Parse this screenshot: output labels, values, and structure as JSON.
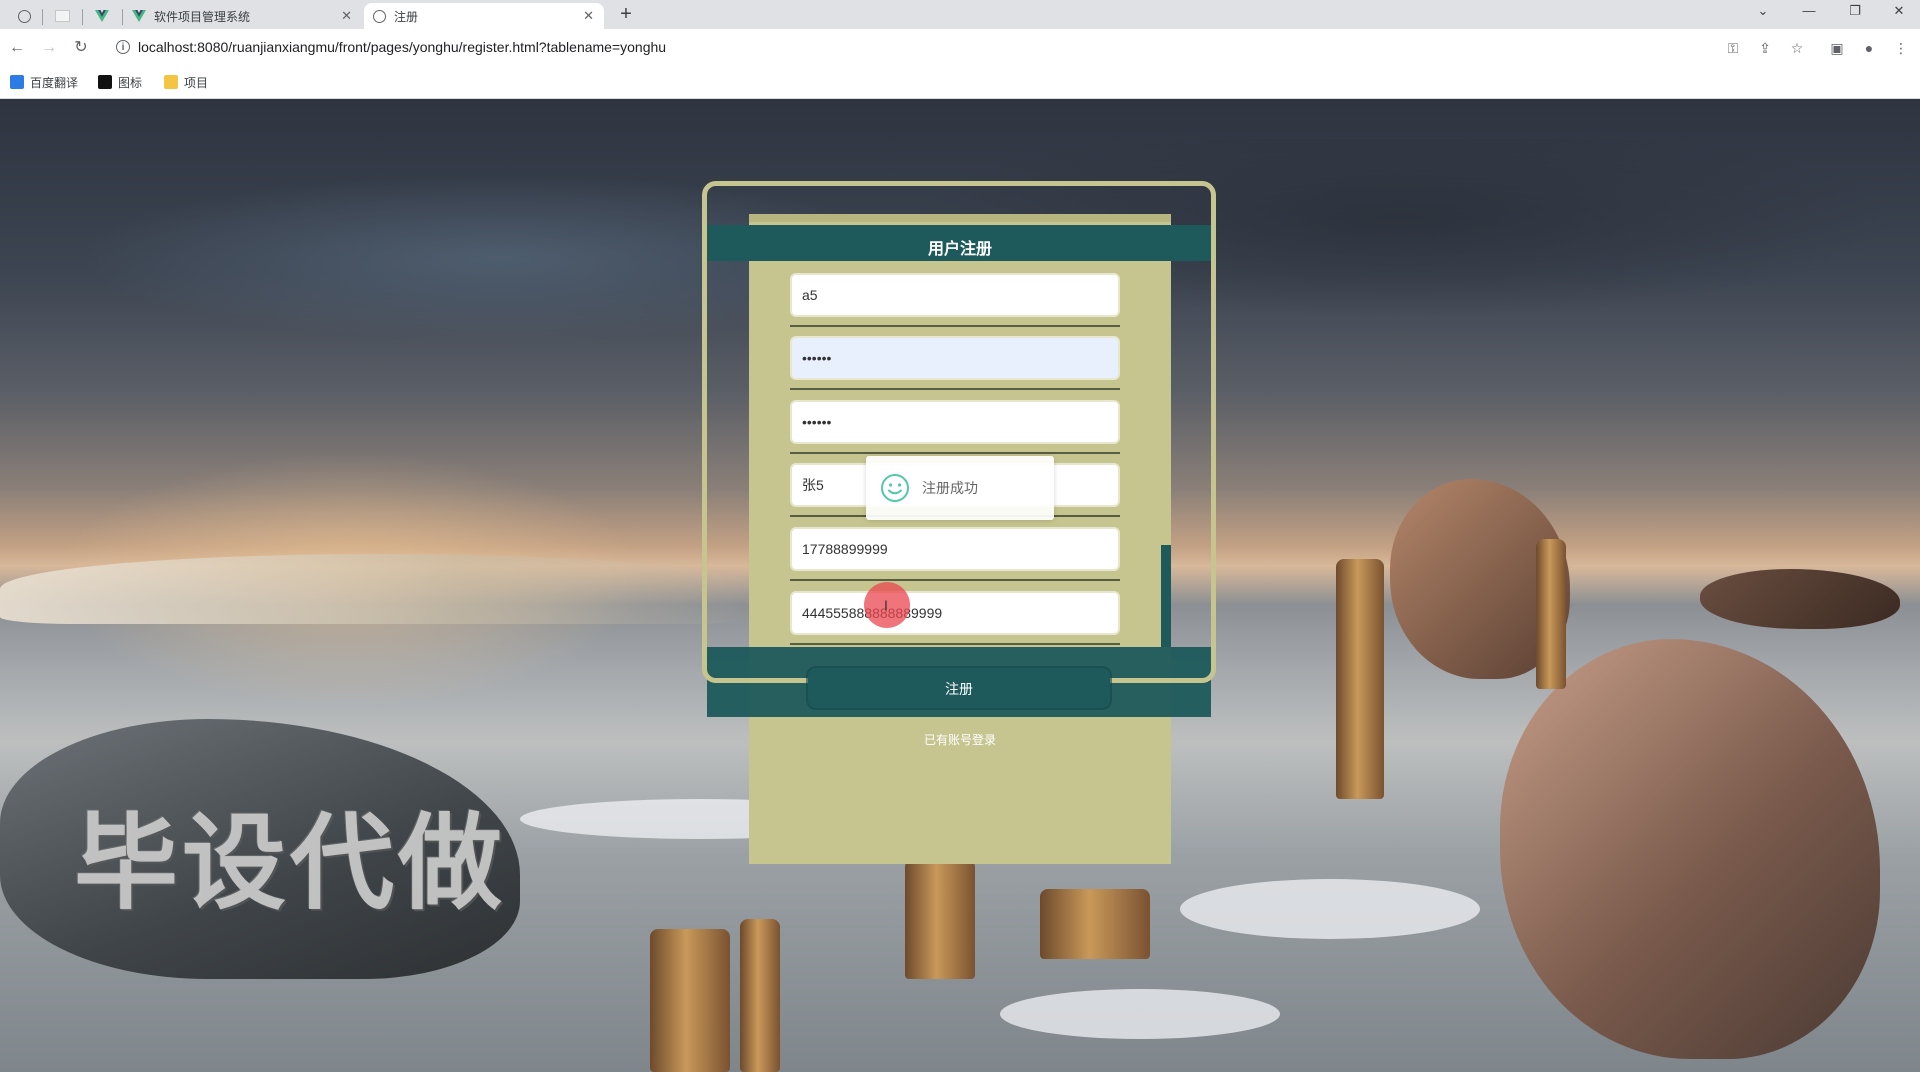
{
  "browser": {
    "tabs": [
      {
        "title": "",
        "kind": "pinned-globe"
      },
      {
        "title": "",
        "kind": "pinned-blank"
      },
      {
        "title": "",
        "kind": "pinned-vue"
      },
      {
        "title": "软件项目管理系统",
        "kind": "tab"
      },
      {
        "title": "注册",
        "kind": "tab-active"
      }
    ],
    "url": "localhost:8080/ruanjianxiangmu/front/pages/yonghu/register.html?tablename=yonghu",
    "bookmarks": [
      {
        "label": "百度翻译",
        "color": "#2d7be5"
      },
      {
        "label": "图标",
        "color": "#111111"
      },
      {
        "label": "项目",
        "color": "#f4c542"
      }
    ]
  },
  "form": {
    "title": "用户注册",
    "fields": [
      {
        "name": "username",
        "value": "a5",
        "type": "text",
        "autofill": false
      },
      {
        "name": "password",
        "value": "••••••",
        "type": "password",
        "autofill": true
      },
      {
        "name": "confirm-password",
        "value": "••••••",
        "type": "password",
        "autofill": false
      },
      {
        "name": "full-name",
        "value": "张5",
        "type": "text",
        "autofill": false
      },
      {
        "name": "phone",
        "value": "17788899999",
        "type": "text",
        "autofill": false
      },
      {
        "name": "id-number",
        "value": "444555888888889999",
        "type": "text",
        "autofill": false
      }
    ],
    "submit_label": "注册",
    "login_link": "已有账号登录"
  },
  "toast": {
    "message": "注册成功",
    "icon": "smile-icon",
    "color": "#53c9a0"
  },
  "watermark": "毕设代做",
  "colors": {
    "panel": "#c7c58f",
    "accent": "#1e5a5b"
  }
}
